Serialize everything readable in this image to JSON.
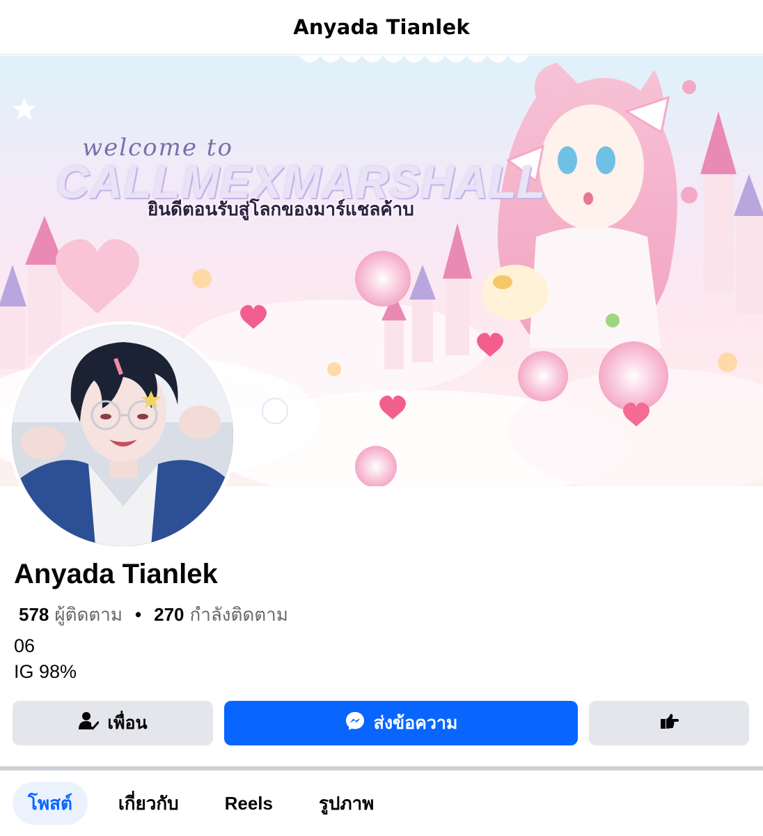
{
  "header": {
    "title": "Anyada Tianlek"
  },
  "cover": {
    "welcome_text": "welcome to",
    "main_text": "CALLMEXMARSHALL",
    "thai_text": "ยินดีตอนรับสู่โลกของมาร์แชลค้าบ"
  },
  "profile": {
    "name": "Anyada Tianlek",
    "followers_count": "578",
    "followers_label": "ผู้ติดตาม",
    "separator": "•",
    "following_count": "270",
    "following_label": "กำลังติดตาม",
    "bio_line1": "06",
    "bio_line2": "IG 98%"
  },
  "actions": {
    "friends_label": "เพื่อน",
    "message_label": "ส่งข้อความ"
  },
  "tabs": [
    {
      "label": "โพสต์",
      "active": true
    },
    {
      "label": "เกี่ยวกับ",
      "active": false
    },
    {
      "label": "Reels",
      "active": false
    },
    {
      "label": "รูปภาพ",
      "active": false
    }
  ],
  "colors": {
    "primary": "#0866ff",
    "button_gray": "#e4e6eb",
    "tab_active_bg": "#ebf2fe",
    "secondary_text": "#65676b"
  },
  "icons": {
    "friends": "person-check-icon",
    "message": "messenger-icon",
    "more": "hand-pointing-icon"
  }
}
